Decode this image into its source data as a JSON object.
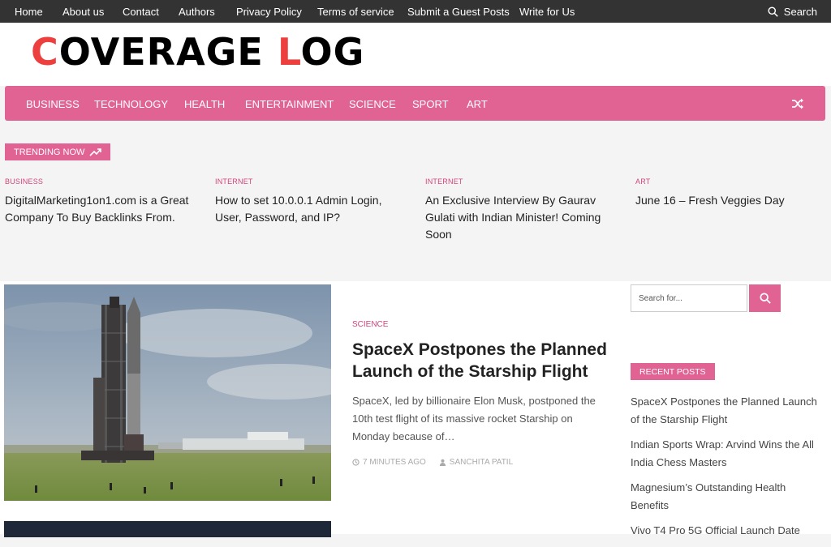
{
  "topnav": {
    "items": [
      "Home",
      "About us",
      "Contact",
      "Authors",
      "Privacy Policy",
      "Terms of service",
      "Submit a Guest Posts",
      "Write for Us"
    ],
    "search_label": "Search"
  },
  "logo": {
    "first_letter": "C",
    "part1": "OVERAGE ",
    "second_letter": "L",
    "part2": "OG"
  },
  "mainnav": {
    "items": [
      "BUSINESS",
      "TECHNOLOGY",
      "HEALTH",
      "ENTERTAINMENT",
      "SCIENCE",
      "SPORT",
      "ART"
    ],
    "shuffle_icon": "shuffle-icon"
  },
  "trending": {
    "badge": "TRENDING NOW",
    "items": [
      {
        "category": "BUSINESS",
        "title": "DigitalMarketing1on1.com is a Great Company To Buy Backlinks From."
      },
      {
        "category": "INTERNET",
        "title": "How to set 10.0.0.1 Admin Login, User, Password, and IP?"
      },
      {
        "category": "INTERNET",
        "title": "An Exclusive Interview By Gaurav Gulati with Indian Minister! Coming Soon"
      },
      {
        "category": "ART",
        "title": "June 16 – Fresh Veggies Day"
      }
    ]
  },
  "featured": {
    "category": "SCIENCE",
    "title": "SpaceX Postpones the Planned Launch of the Starship Flight",
    "excerpt": "SpaceX, led by billionaire Elon Musk, postponed the 10th test flight of its massive rocket Starship on Monday because of…",
    "time": "7 MINUTES AGO",
    "author": "SANCHITA PATIL"
  },
  "sidebar": {
    "search_placeholder": "Search for...",
    "recent_badge": "RECENT POSTS",
    "recent_posts": [
      "SpaceX Postpones the Planned Launch of the Starship Flight",
      "Indian Sports Wrap: Arvind Wins the All India Chess Masters",
      "Magnesium’s Outstanding Health Benefits",
      "Vivo T4 Pro 5G Official Launch Date"
    ]
  },
  "colors": {
    "accent": "#e06394",
    "logo_red": "#ee3f3f",
    "topbar": "#333333"
  }
}
